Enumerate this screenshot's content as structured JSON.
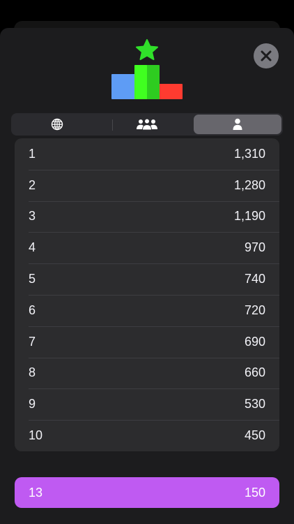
{
  "colors": {
    "accent": "#bf5af2",
    "podium_first": "#34c759",
    "podium_second": "#5e9cf5",
    "podium_third": "#ff3b30",
    "star": "#30e02a"
  },
  "header": {
    "logo_icon": "podium-star-icon",
    "close_icon": "close-icon"
  },
  "tabs": [
    {
      "icon": "globe-icon",
      "selected": false
    },
    {
      "icon": "group-icon",
      "selected": false
    },
    {
      "icon": "person-icon",
      "selected": true
    }
  ],
  "leaderboard": [
    {
      "rank": "1",
      "score": "1,310"
    },
    {
      "rank": "2",
      "score": "1,280"
    },
    {
      "rank": "3",
      "score": "1,190"
    },
    {
      "rank": "4",
      "score": "970"
    },
    {
      "rank": "5",
      "score": "740"
    },
    {
      "rank": "6",
      "score": "720"
    },
    {
      "rank": "7",
      "score": "690"
    },
    {
      "rank": "8",
      "score": "660"
    },
    {
      "rank": "9",
      "score": "530"
    },
    {
      "rank": "10",
      "score": "450"
    }
  ],
  "current_player": {
    "rank": "13",
    "score": "150"
  }
}
